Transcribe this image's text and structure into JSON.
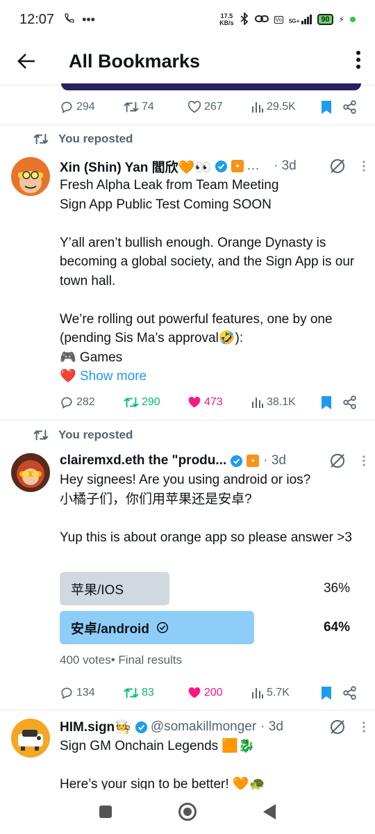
{
  "status_bar": {
    "time": "12:07",
    "net_speed_value": "17.5",
    "net_speed_unit": "KB/s",
    "signal": "5G+",
    "battery": "90"
  },
  "header": {
    "title": "All Bookmarks",
    "back_icon": "arrow-left-icon",
    "more_icon": "vertical-dots-icon"
  },
  "first_tweet_stats": {
    "replies": "294",
    "reposts": "74",
    "likes": "267",
    "views": "29.5K"
  },
  "tweets": [
    {
      "repost_label": "You reposted",
      "name": "Xin (Shin) Yan 閻欣🧡👀",
      "handle": "…",
      "time": "· 3d",
      "body": "Fresh Alpha Leak from Team Meeting\nSign App Public Test Coming SOON\n\nY’all aren’t bullish enough. Orange Dynasty is becoming a global society, and the Sign App is our town hall.\n\nWe’re rolling out powerful features, one by one (pending Sis Ma’s approval🤣):\n🎮 Games",
      "heart_prefix": "❤️",
      "show_more": "Show more",
      "stats": {
        "replies": "282",
        "reposts": "290",
        "likes": "473",
        "views": "38.1K"
      }
    },
    {
      "repost_label": "You reposted",
      "name": "clairemxd.eth the \"produ...",
      "time": "· 3d",
      "body": "Hey signees! Are you using android or ios?\n小橘子们，你们用苹果还是安卓?\n\nYup this is about orange app so please answer >3",
      "poll": {
        "options": [
          {
            "label": "苹果/IOS",
            "percent": "36%",
            "fraction": 0.36,
            "selected": false
          },
          {
            "label": "安卓/android",
            "percent": "64%",
            "fraction": 0.64,
            "selected": true
          }
        ],
        "meta": "400 votes• Final results"
      },
      "stats": {
        "replies": "134",
        "reposts": "83",
        "likes": "200",
        "views": "5.7K"
      }
    },
    {
      "name": "HIM.sign🧑‍🍳",
      "handle": "@somakillmonger",
      "time": "· 3d",
      "body": "Sign GM Onchain Legends 🟧🐉\n\nHere’s your sign to be better! 🧡🐢"
    }
  ],
  "colors": {
    "accent": "#1d9bf0",
    "repost_active": "#00ba7c",
    "like_active": "#f91880",
    "muted": "#536471",
    "poll_selected": "#8ecdf8",
    "poll_unselected": "#cfd9de"
  }
}
